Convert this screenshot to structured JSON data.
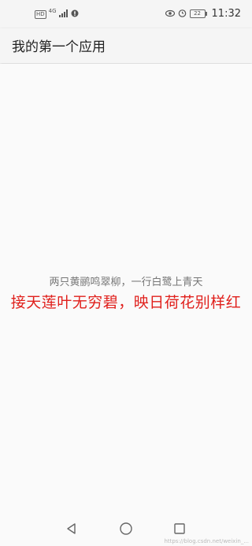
{
  "status_bar": {
    "hd_badge": "HD",
    "network": "4G",
    "battery_level": "22",
    "time": "11:32"
  },
  "app_bar": {
    "title": "我的第一个应用"
  },
  "content": {
    "line1": "两只黄鹂鸣翠柳，一行白鹭上青天",
    "line2": "接天莲叶无穷碧，映日荷花别样红",
    "line2_color": "#e0201c"
  },
  "nav_bar": {
    "icons": [
      "back-icon",
      "home-icon",
      "recents-icon"
    ]
  },
  "watermark": "https://blog.csdn.net/weixin_..."
}
